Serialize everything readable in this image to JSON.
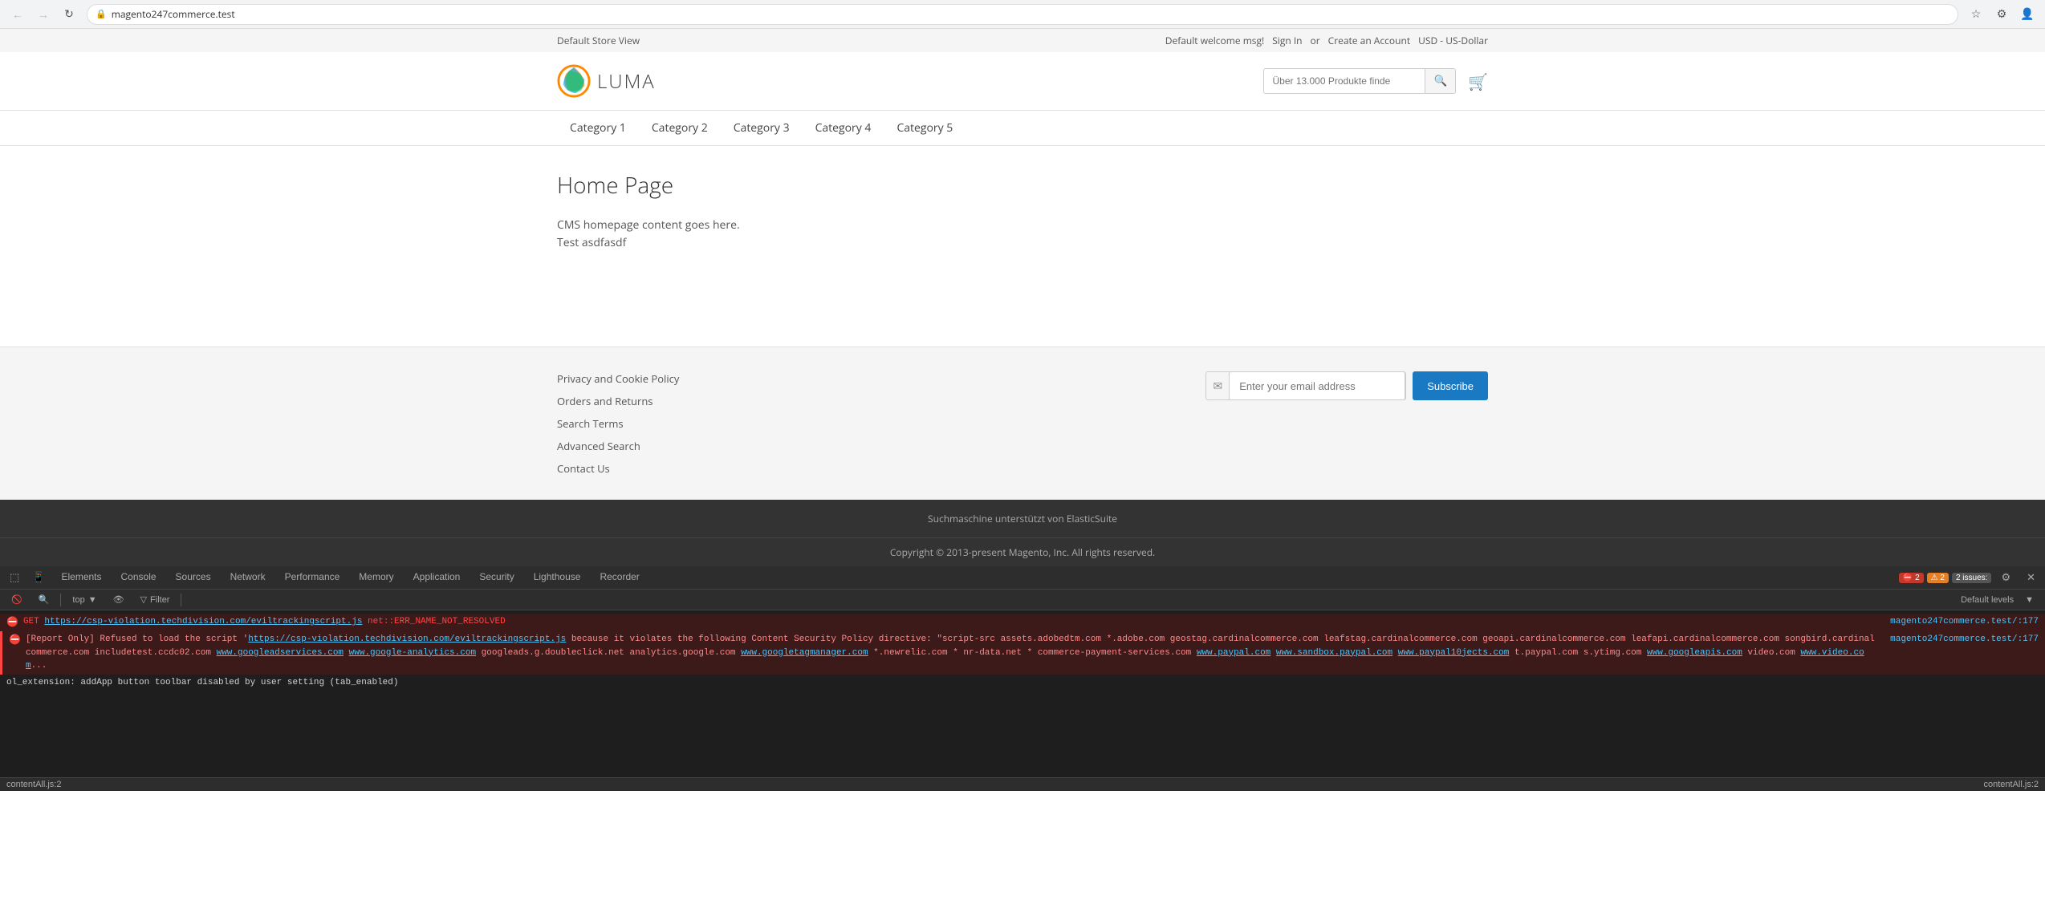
{
  "browser": {
    "url": "magento247commerce.test",
    "back_disabled": true,
    "forward_disabled": true
  },
  "topbar": {
    "store_view": "Default Store View",
    "welcome": "Default welcome msg!",
    "sign_in": "Sign In",
    "or": "or",
    "create_account": "Create an Account",
    "currency": "USD - US-Dollar"
  },
  "header": {
    "logo_text": "LUMA",
    "search_placeholder": "Über 13.000 Produkte finde",
    "cart_title": "Shopping Cart"
  },
  "navigation": {
    "items": [
      {
        "label": "Category 1"
      },
      {
        "label": "Category 2"
      },
      {
        "label": "Category 3"
      },
      {
        "label": "Category 4"
      },
      {
        "label": "Category 5"
      }
    ]
  },
  "main": {
    "page_title": "Home Page",
    "cms_line1": "CMS homepage content goes here.",
    "cms_line2": "Test asdfasdf"
  },
  "footer": {
    "links": [
      {
        "label": "Privacy and Cookie Policy"
      },
      {
        "label": "Orders and Returns"
      },
      {
        "label": "Search Terms"
      },
      {
        "label": "Advanced Search"
      },
      {
        "label": "Contact Us"
      }
    ],
    "newsletter_placeholder": "Enter your email address",
    "subscribe_label": "Subscribe",
    "bottom_text": "Suchmaschine unterstützt von ElasticSuite",
    "copyright": "Copyright © 2013-present Magento, Inc. All rights reserved."
  },
  "devtools": {
    "tabs": [
      {
        "label": "Elements",
        "active": false
      },
      {
        "label": "Console",
        "active": false
      },
      {
        "label": "Sources",
        "active": false
      },
      {
        "label": "Network",
        "active": false
      },
      {
        "label": "Performance",
        "active": false
      },
      {
        "label": "Memory",
        "active": false
      },
      {
        "label": "Application",
        "active": false
      },
      {
        "label": "Security",
        "active": false
      },
      {
        "label": "Lighthouse",
        "active": false
      },
      {
        "label": "Recorder",
        "active": false
      }
    ],
    "toolbar": {
      "level_label": "top",
      "filter_label": "Filter",
      "default_levels": "Default levels",
      "issues_count": "2",
      "issues_label": "2 issues:"
    },
    "errors": {
      "error1_prefix": "GET ",
      "error1_url": "https://csp-violation.techdivision.com/eviltrackingscript.js",
      "error1_msg": " net::ERR_NAME_NOT_RESOLVED",
      "error2_prefix": "[Report Only] Refused to load the script '",
      "error2_url": "https://csp-violation.techdivision.com/eviltrackingscript.js",
      "error2_msg": "' because it violates the following Content Security Policy directive: \"script-src assets.adobedtm.com *.adobe.com geostag.cardinalcommerce.com leafstag.cardinalcommerce.com geoapi.cardinalcommerce.com leafapi.cardinalcommerce.com songbird.cardinalcommerce.com includetest.ccdc02.com",
      "error2_links": [
        "www.googleadservices.com",
        "www.google-analytics.com"
      ],
      "source_ref": "magento247commerce.test/:177",
      "console_ext": "ol_extension: addApp button toolbar disabled by user setting (tab_enabled)"
    },
    "statusbar": {
      "content_left": "contentAll.js:2",
      "content_right": "contentAll.js:2"
    }
  }
}
